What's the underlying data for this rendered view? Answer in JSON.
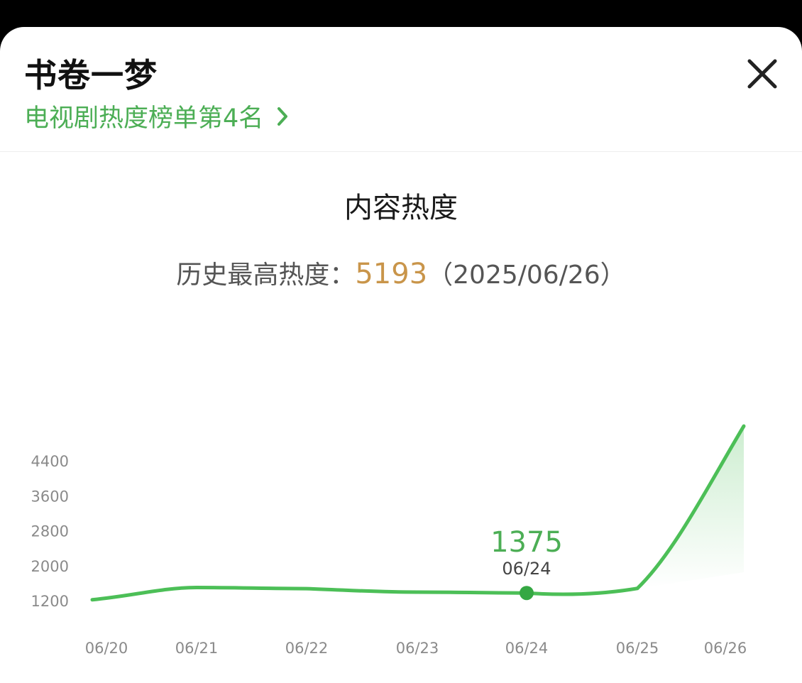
{
  "header": {
    "title": "书卷一梦",
    "rank_link": "电视剧热度榜单第4名"
  },
  "section_title": "内容热度",
  "peak": {
    "label": "历史最高热度：",
    "value": "5193",
    "date": "（2025/06/26）"
  },
  "colors": {
    "accent_green": "#4cae55",
    "peak_gold": "#c9954a"
  },
  "icons": {
    "close": "close-icon",
    "chevron": "chevron-right-icon"
  },
  "chart_data": {
    "type": "line",
    "x": [
      "06/20",
      "06/21",
      "06/22",
      "06/23",
      "06/24",
      "06/25",
      "06/26"
    ],
    "values": [
      1220,
      1500,
      1475,
      1395,
      1375,
      1480,
      5193
    ],
    "yticks": [
      1200,
      2000,
      2800,
      3600,
      4400
    ],
    "ylim": [
      1200,
      5193
    ],
    "highlight": {
      "x": "06/24",
      "value": "1375",
      "label": "06/24"
    },
    "grid": false,
    "legend": "none"
  }
}
